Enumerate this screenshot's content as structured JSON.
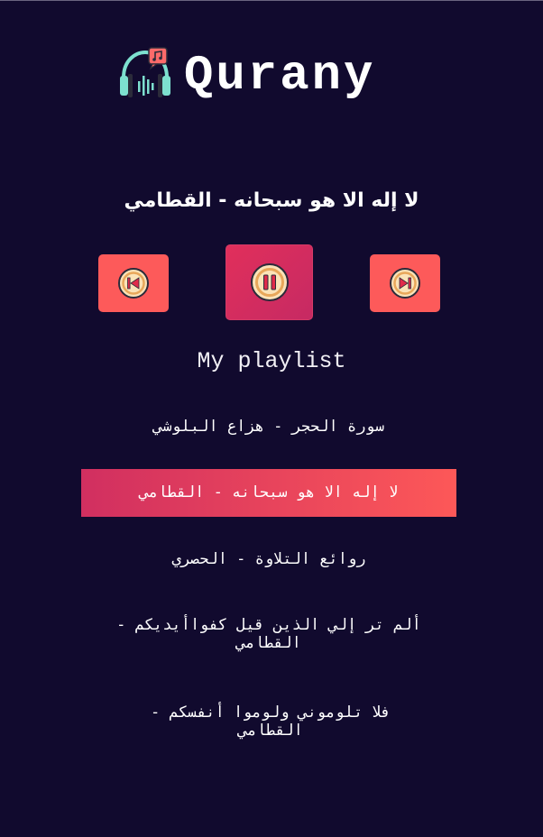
{
  "app": {
    "title": "Qurany",
    "logo_icon": "headphones-music-note-icon"
  },
  "player": {
    "now_playing": "لا إله الا هو سبحانه - القطامي",
    "controls": {
      "previous_icon": "skip-previous-icon",
      "pause_icon": "pause-icon",
      "next_icon": "skip-next-icon"
    }
  },
  "playlist": {
    "heading": "My playlist",
    "tracks": [
      {
        "label": "سورة الحجر - هزاع البلوشي",
        "active": false
      },
      {
        "label": "لا إله الا هو سبحانه - القطامي",
        "active": true
      },
      {
        "label": "روائع التلاوة - الحصري",
        "active": false
      },
      {
        "label": "ألم تر إلي الذين قيل كفواأيديكم - القطامي",
        "active": false
      },
      {
        "label": "فلا تلوموني ولوموا أنفسكم - القطامي",
        "active": false
      }
    ]
  },
  "colors": {
    "background": "#110a2e",
    "accent_coral": "#fd5a5a",
    "accent_pink": "#d12f60"
  }
}
